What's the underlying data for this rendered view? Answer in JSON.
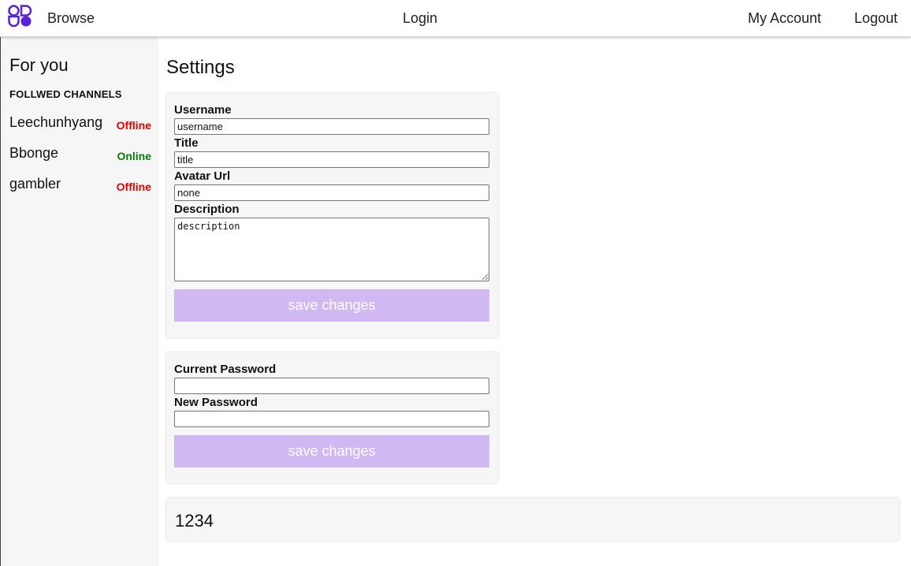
{
  "header": {
    "browse_label": "Browse",
    "login_label": "Login",
    "my_account_label": "My Account",
    "logout_label": "Logout",
    "logo_icon": "brand-logo-icon",
    "brand_color": "#5b21d6"
  },
  "sidebar": {
    "title": "For you",
    "subtitle": "FOLLWED CHANNELS",
    "channels": [
      {
        "name": "Leechunhyang",
        "status": "Offline"
      },
      {
        "name": "Bbonge",
        "status": "Online"
      },
      {
        "name": "gambler",
        "status": "Offline"
      }
    ],
    "status_colors": {
      "Offline": "#e00000",
      "Online": "#0b7a0b"
    }
  },
  "main": {
    "title": "Settings",
    "settings_form": {
      "username_label": "Username",
      "username_value": "username",
      "title_label": "Title",
      "title_value": "title",
      "avatar_label": "Avatar Url",
      "avatar_value": "none",
      "description_label": "Description",
      "description_value": "description",
      "save_label": "save changes"
    },
    "password_form": {
      "current_label": "Current Password",
      "current_value": "",
      "new_label": "New Password",
      "new_value": "",
      "save_label": "save changes"
    },
    "info_card": {
      "value": "1234"
    },
    "accent_color": "#d0b9f3"
  }
}
